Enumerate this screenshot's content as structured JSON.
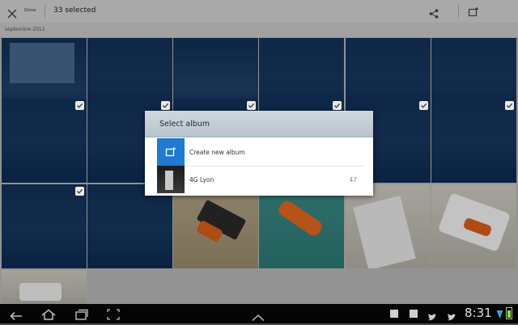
{
  "actionbar": {
    "done_label": "Done",
    "selection_count": "33 selected",
    "share_icon": "share-icon",
    "add_to_album_icon": "add-to-album-icon"
  },
  "section": {
    "date_label": "septembre 2012"
  },
  "dialog": {
    "title": "Select album",
    "items": [
      {
        "label": "Create new album",
        "icon": "create-album-icon"
      },
      {
        "label": "4G Lyon",
        "count": "47"
      }
    ]
  },
  "navbar": {
    "time": "8:31"
  },
  "colors": {
    "selection_overlay": "#053470",
    "accent_blue": "#1e7ad3",
    "dialog_header": "#c5d0d8"
  }
}
